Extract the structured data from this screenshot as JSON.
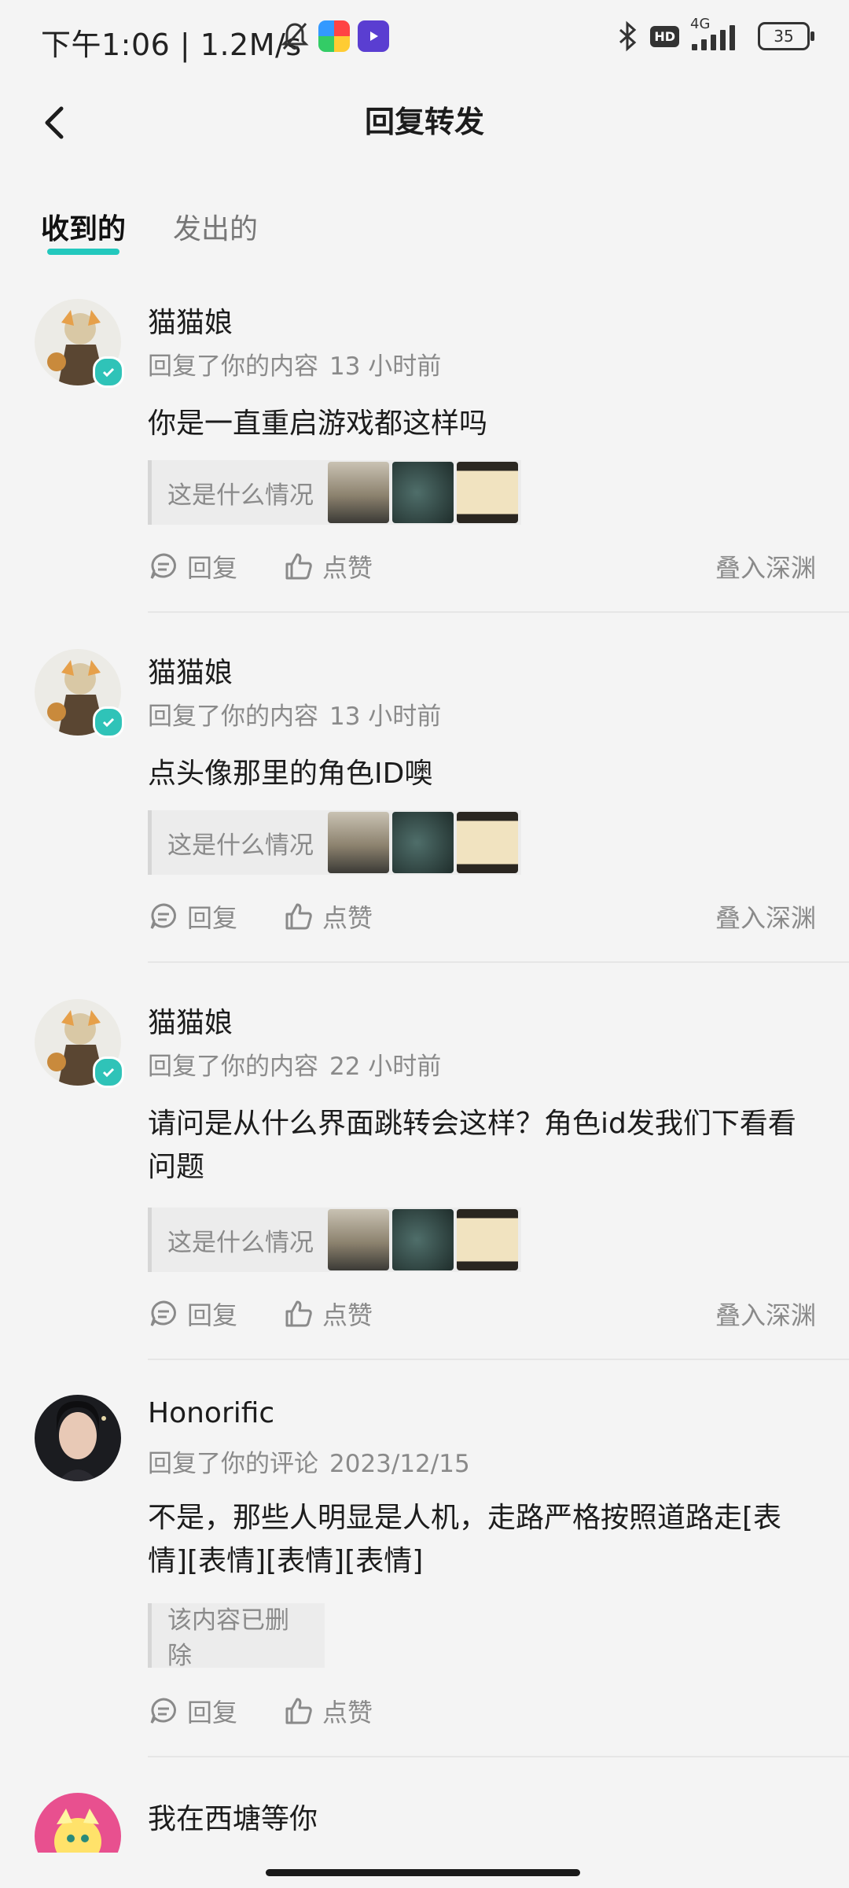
{
  "status_bar": {
    "time": "下午1:06 | 1.2M/s",
    "network": "4G",
    "hd": "HD",
    "battery": "35"
  },
  "header": {
    "title": "回复转发"
  },
  "tabs": [
    {
      "label": "收到的",
      "active": true
    },
    {
      "label": "发出的",
      "active": false
    }
  ],
  "items": [
    {
      "username": "猫猫娘",
      "action": "回复了你的内容",
      "time": "13 小时前",
      "content": "你是一直重启游戏都这样吗",
      "quote": "这是什么情况",
      "reply_label": "回复",
      "like_label": "点赞",
      "abyss_label": "叠入深渊"
    },
    {
      "username": "猫猫娘",
      "action": "回复了你的内容",
      "time": "13 小时前",
      "content": "点头像那里的角色ID噢",
      "quote": "这是什么情况",
      "reply_label": "回复",
      "like_label": "点赞",
      "abyss_label": "叠入深渊"
    },
    {
      "username": "猫猫娘",
      "action": "回复了你的内容",
      "time": "22 小时前",
      "content": "请问是从什么界面跳转会这样？角色id发我们下看看问题",
      "quote": "这是什么情况",
      "reply_label": "回复",
      "like_label": "点赞",
      "abyss_label": "叠入深渊"
    },
    {
      "username": "Honorific",
      "action": "回复了你的评论",
      "time": "2023/12/15",
      "content": "不是，那些人明显是人机，走路严格按照道路走[表情][表情][表情][表情]",
      "quote": "该内容已删除",
      "reply_label": "回复",
      "like_label": "点赞"
    },
    {
      "username": "我在西塘等你"
    }
  ],
  "colors": {
    "accent": "#23c8bd",
    "verify_badge": "#2fc3b8",
    "muted_text": "#8a8a8a",
    "background": "#f4f4f4"
  }
}
